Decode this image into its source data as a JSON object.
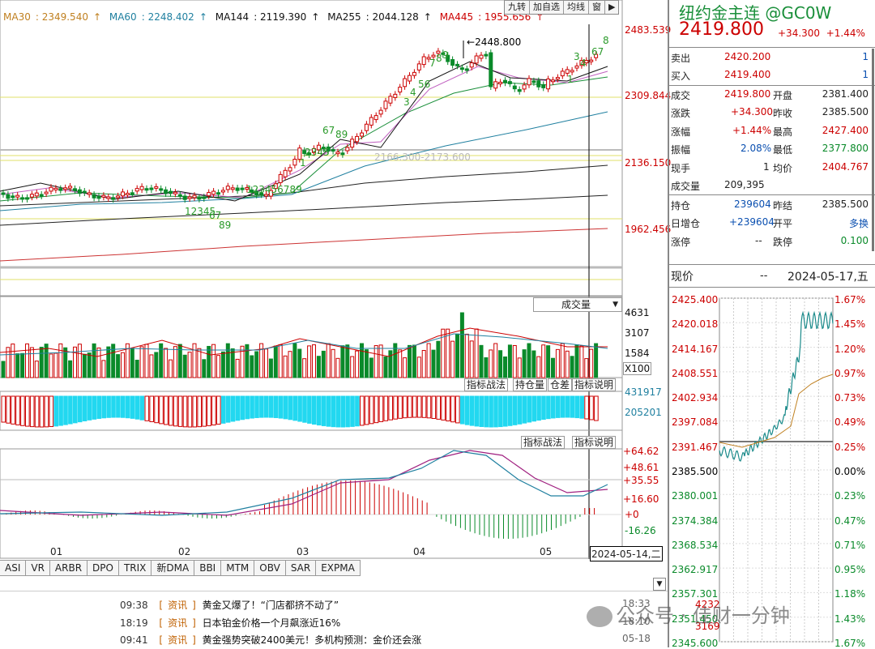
{
  "ma_labels": [
    {
      "name": "MA30",
      "value": "2349.540",
      "color": "#c08020"
    },
    {
      "name": "MA60",
      "value": "2248.402",
      "color": "#2080a0"
    },
    {
      "name": "MA144",
      "value": "2119.390",
      "color": "#111"
    },
    {
      "name": "MA255",
      "value": "2044.128",
      "color": "#111"
    },
    {
      "name": "MA445",
      "value": "1955.656",
      "color": "#c00"
    }
  ],
  "top_buttons": [
    "九转",
    "加自选",
    "均线",
    "窗"
  ],
  "price_axis": [
    "2483.539",
    "2309.844",
    "2136.150",
    "1962.456"
  ],
  "peak_label": "2448.800",
  "zone_label": "2166.300-2173.600",
  "volume_indicator": "成交量",
  "volume_axis": [
    "4631",
    "3107",
    "1584",
    "X100"
  ],
  "ind2_axis": [
    "431917",
    "205201"
  ],
  "ind3_axis": [
    "+64.62",
    "+48.61",
    "+35.55",
    "+16.60",
    "+0",
    "-16.26"
  ],
  "ind_buttons": {
    "a": "指标战法",
    "b": "持仓量",
    "c": "仓差",
    "d": "指标说明",
    "e": "指标战法",
    "f": "指标说明"
  },
  "months": [
    "01",
    "02",
    "03",
    "04",
    "05"
  ],
  "cursor_date": "2024-05-14,二",
  "tabs": [
    "ASI",
    "VR",
    "ARBR",
    "DPO",
    "TRIX",
    "新DMA",
    "BBI",
    "MTM",
    "OBV",
    "SAR",
    "EXPMA"
  ],
  "news": [
    {
      "time": "09:38",
      "tag": "资讯",
      "title": "黄金又爆了！“门店都挤不动了”",
      "right": "18:33"
    },
    {
      "time": "18:19",
      "tag": "资讯",
      "title": "日本铂金价格一个月飙涨近16%",
      "right": "18:10"
    },
    {
      "time": "09:41",
      "tag": "资讯",
      "title": "黄金强势突破2400美元！多机构预测：金价还会涨",
      "right": "05-18"
    }
  ],
  "quote": {
    "title": "纽约金主连 @GC0W",
    "price": "2419.800",
    "change": "+34.300",
    "pct": "+1.44%",
    "sell_label": "卖出",
    "sell_price": "2420.200",
    "sell_qty": "1",
    "buy_label": "买入",
    "buy_price": "2419.400",
    "buy_qty": "1",
    "rows": [
      {
        "l1": "成交",
        "v1": "2419.800",
        "l2": "开盘",
        "v2": "2381.400"
      },
      {
        "l1": "涨跌",
        "v1": "+34.300",
        "l2": "昨收",
        "v2": "2385.500"
      },
      {
        "l1": "涨幅",
        "v1": "+1.44%",
        "l2": "最高",
        "v2": "2427.400"
      },
      {
        "l1": "振幅",
        "v1": "2.08%",
        "l2": "最低",
        "v2": "2377.800"
      },
      {
        "l1": "现手",
        "v1": "1",
        "l2": "均价",
        "v2": "2404.767"
      },
      {
        "l1": "成交量",
        "v1": "209,395",
        "l2": "",
        "v2": ""
      }
    ],
    "rows2": [
      {
        "l1": "持仓",
        "v1": "239604",
        "l2": "昨结",
        "v2": "2385.500"
      },
      {
        "l1": "日增仓",
        "v1": "+239604",
        "l2": "开平",
        "v2": "多换"
      },
      {
        "l1": "涨停",
        "v1": "--",
        "l2": "跌停",
        "v2": "0.100"
      }
    ],
    "now_label": "现价",
    "now_dash": "--",
    "now_date": "2024-05-17,五"
  },
  "mini_price_axis": [
    "2425.400",
    "2420.018",
    "2414.167",
    "2408.551",
    "2402.934",
    "2397.084",
    "2391.467",
    "2385.500",
    "2380.001",
    "2374.384",
    "2368.534",
    "2362.917",
    "2357.301",
    "2351.450",
    "2345.600"
  ],
  "mini_pct_axis": [
    "1.67%",
    "1.45%",
    "1.20%",
    "0.97%",
    "0.73%",
    "0.49%",
    "0.25%",
    "0.00%",
    "0.23%",
    "0.47%",
    "0.71%",
    "0.95%",
    "1.18%",
    "1.43%",
    "1.67%"
  ],
  "mini_vol_axis": [
    "4232",
    "3169"
  ],
  "watermark": "公众号 · 佳财一分钟"
}
